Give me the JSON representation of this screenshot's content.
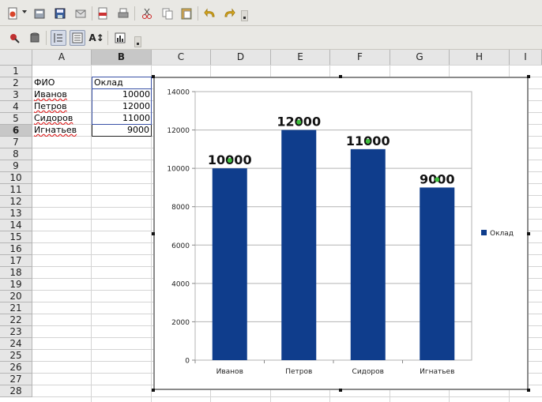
{
  "toolbar": {
    "row1": [
      "new-document-icon",
      "open-icon",
      "save-icon",
      "email-icon",
      "export-pdf-icon",
      "print-icon",
      "cut-icon",
      "copy-icon",
      "paste-icon",
      "undo-icon",
      "redo-icon"
    ],
    "row2": [
      "insert-object-icon",
      "data-source-icon",
      "edit-points-icon",
      "chart-area-icon",
      "text-scale-icon",
      "chart-type-icon"
    ],
    "text_scale_label": "A↕"
  },
  "grid": {
    "columns": [
      "A",
      "B",
      "C",
      "D",
      "E",
      "F",
      "G",
      "H",
      "I"
    ],
    "selected_column": "B",
    "rows": [
      "1",
      "2",
      "3",
      "4",
      "5",
      "6",
      "7",
      "8",
      "9",
      "10",
      "11",
      "12",
      "13",
      "14",
      "15",
      "16",
      "17",
      "18",
      "19",
      "20",
      "21",
      "22",
      "23",
      "24",
      "25",
      "26",
      "27",
      "28"
    ],
    "selected_row": "6",
    "cells": {
      "a2": "ФИО",
      "b2": "Оклад",
      "a3": "Иванов",
      "b3": "10000",
      "a4": "Петров",
      "b4": "12000",
      "a5": "Сидоров",
      "b5": "11000",
      "a6": "Игнатьев",
      "b6": "9000"
    }
  },
  "chart_data": {
    "type": "bar",
    "categories": [
      "Иванов",
      "Петров",
      "Сидоров",
      "Игнатьев"
    ],
    "series": [
      {
        "name": "Оклад",
        "values": [
          10000,
          12000,
          11000,
          9000
        ],
        "color": "#0f3d8c"
      }
    ],
    "data_labels": [
      "10000",
      "12000",
      "11000",
      "9000"
    ],
    "ylim": [
      0,
      14000
    ],
    "yticks": [
      0,
      2000,
      4000,
      6000,
      8000,
      10000,
      12000,
      14000
    ],
    "grid": true,
    "legend": "right",
    "title": "",
    "xlabel": "",
    "ylabel": ""
  }
}
